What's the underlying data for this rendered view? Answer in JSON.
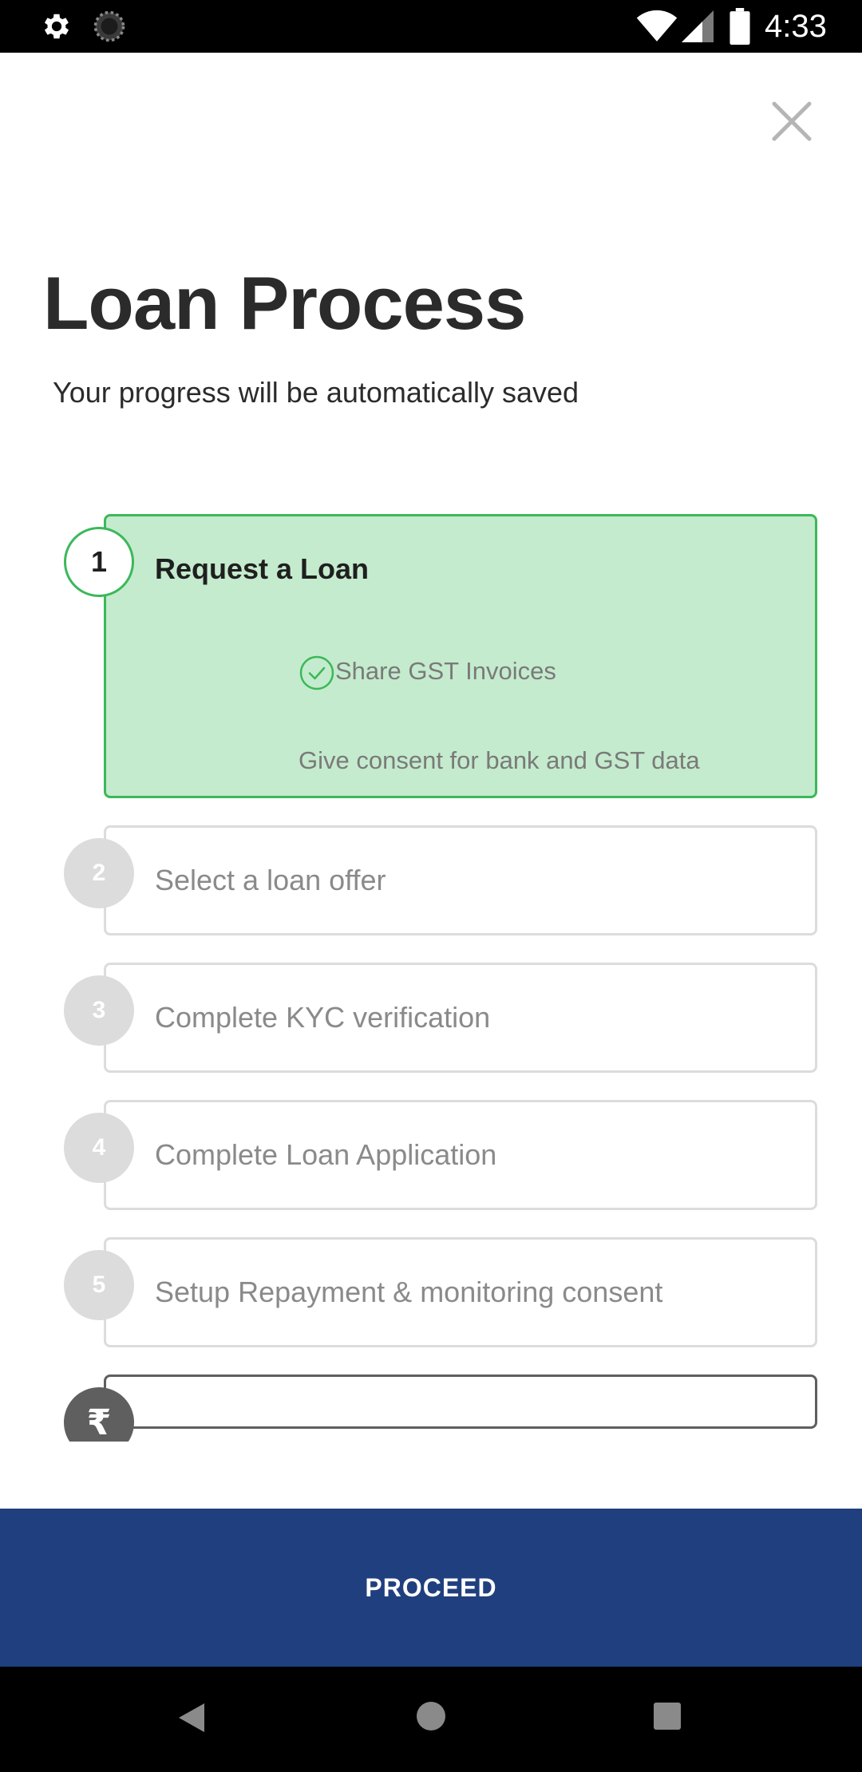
{
  "status_bar": {
    "time": "4:33",
    "icons": [
      "gear-icon",
      "spinner-icon",
      "wifi-icon",
      "signal-icon",
      "battery-icon"
    ]
  },
  "header": {
    "close_icon": "close-icon",
    "title": "Loan Process",
    "subtitle": "Your progress will be automatically saved"
  },
  "steps": [
    {
      "number": "1",
      "label": "Request a Loan",
      "status": "active",
      "substeps": [
        {
          "label": "Share GST Invoices",
          "done": true
        },
        {
          "label": "Give consent for bank and GST data",
          "done": false
        }
      ]
    },
    {
      "number": "2",
      "label": "Select a loan offer",
      "status": "pending"
    },
    {
      "number": "3",
      "label": "Complete KYC verification",
      "status": "pending"
    },
    {
      "number": "4",
      "label": "Complete Loan Application",
      "status": "pending"
    },
    {
      "number": "5",
      "label": "Setup Repayment & monitoring consent",
      "status": "pending"
    },
    {
      "number": "₹",
      "label": "",
      "status": "disbursal"
    }
  ],
  "footer": {
    "proceed_label": "PROCEED"
  },
  "colors": {
    "active_green": "#3bb85a",
    "active_fill": "#c4ebcd",
    "primary_blue": "#203f7e",
    "inactive_gray": "#dcdcdc"
  }
}
